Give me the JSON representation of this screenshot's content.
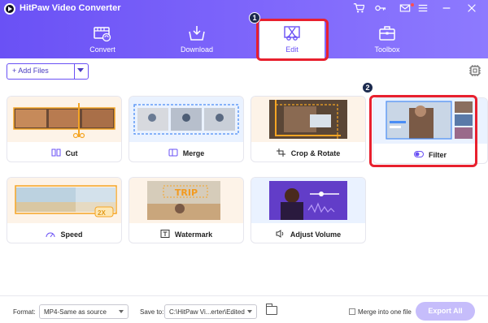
{
  "app": {
    "title": "HitPaw Video Converter"
  },
  "tabs": [
    {
      "label": "Convert",
      "active": false
    },
    {
      "label": "Download",
      "active": false
    },
    {
      "label": "Edit",
      "active": true
    },
    {
      "label": "Toolbox",
      "active": false
    }
  ],
  "annotations": {
    "step1": "1",
    "step2": "2"
  },
  "toolbar": {
    "add_files_label": "+ Add Files"
  },
  "tools": [
    {
      "label": "Cut",
      "icon": "cut-icon"
    },
    {
      "label": "Merge",
      "icon": "merge-icon"
    },
    {
      "label": "Crop & Rotate",
      "icon": "crop-icon"
    },
    {
      "label": "Filter",
      "icon": "filter-toggle-icon"
    },
    {
      "label": "Speed",
      "icon": "speedometer-icon",
      "thumb_badge": "2X"
    },
    {
      "label": "Watermark",
      "icon": "watermark-icon",
      "thumb_text": "TRIP"
    },
    {
      "label": "Adjust Volume",
      "icon": "speaker-icon"
    }
  ],
  "bottom": {
    "format_label": "Format:",
    "format_value": "MP4-Same as source",
    "save_label": "Save to:",
    "save_value": "C:\\HitPaw Vi...erter\\Edited",
    "merge_label": "Merge into one file",
    "merge_checked": false,
    "export_label": "Export All"
  },
  "colors": {
    "brand": "#6a51f5",
    "highlight": "#e8202e",
    "export_disabled": "#c6bdfb"
  }
}
